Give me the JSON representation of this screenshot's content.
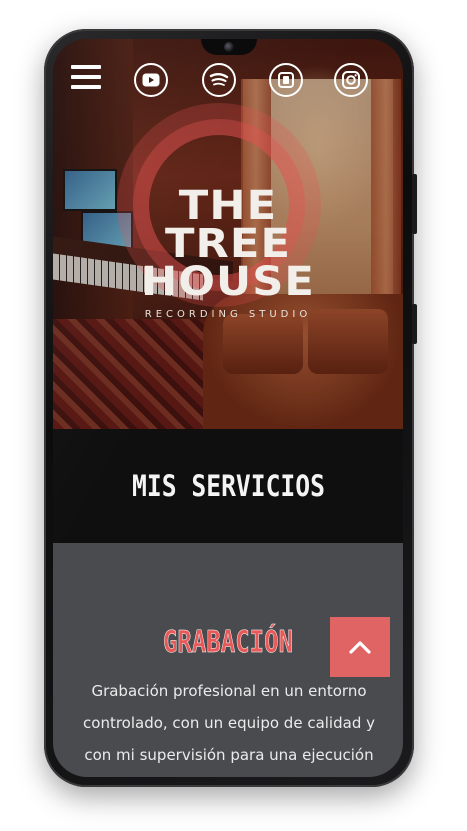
{
  "nav": {
    "menu_icon": "hamburger-menu-icon",
    "social_icons": [
      "youtube-icon",
      "spotify-icon",
      "bandcamp-icon",
      "instagram-icon"
    ]
  },
  "logo": {
    "line1": "THE",
    "line2": "TREE",
    "line3": "HOUSE",
    "subtitle": "RECORDING STUDIO"
  },
  "section": {
    "title": "MIS SERVICIOS"
  },
  "service": {
    "heading": "GRABACIÓN",
    "description": "Grabación profesional en un entorno controlado, con un equipo de calidad y con mi supervisión para una ejecución"
  },
  "colors": {
    "accent": "#e06464",
    "dark_band": "#0f0f10",
    "card_bg": "#4a4b4f"
  },
  "scroll_top_icon": "chevron-up-icon"
}
